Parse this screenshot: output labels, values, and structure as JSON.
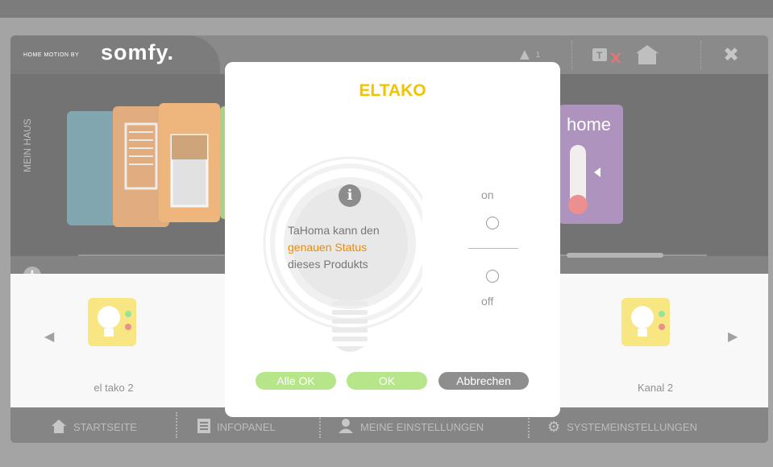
{
  "header": {
    "logo_small": "HOME MOTION BY",
    "logo_big": "somfy.",
    "alert_count": "1"
  },
  "main": {
    "vertical_label": "MEIN HAUS",
    "tile_home_label": "home"
  },
  "products": {
    "items": [
      {
        "label": "el tako 2"
      },
      {
        "label": "Kanal 2"
      }
    ]
  },
  "footer": {
    "items": [
      {
        "label": "STARTSEITE"
      },
      {
        "label": "INFOPANEL"
      },
      {
        "label": "MEINE EINSTELLUNGEN"
      },
      {
        "label": "SYSTEMEINSTELLUNGEN"
      }
    ]
  },
  "dialog": {
    "title": "ELTAKO",
    "status_line1": "TaHoma kann den",
    "status_highlight": "genauen Status",
    "status_line3": "dieses Produkts",
    "on_label": "on",
    "off_label": "off",
    "buttons": {
      "all_ok": "Alle OK",
      "ok": "OK",
      "cancel": "Abbrechen"
    }
  },
  "colors": {
    "accent_yellow": "#f2c400",
    "highlight_orange": "#f08a00",
    "button_green": "#b6e58a",
    "button_gray": "#8e8e8e",
    "product_yellow": "#f0d21a"
  }
}
